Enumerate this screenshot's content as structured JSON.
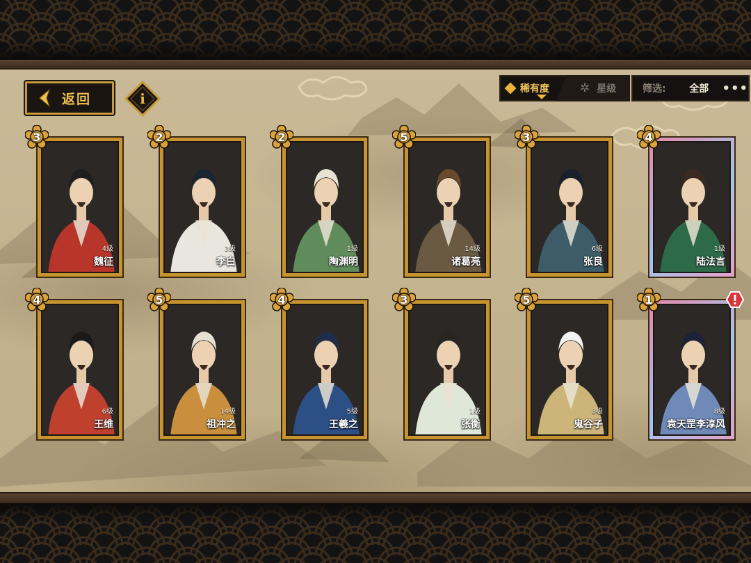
{
  "nav": {
    "back_label": "返回",
    "info_glyph": "i"
  },
  "sort": {
    "rarity_label": "稀有度",
    "star_label": "星级",
    "rarity_active": true
  },
  "filter": {
    "label": "筛选:",
    "value": "全部",
    "more": "•••"
  },
  "colors": {
    "accent_gold": "#c79a3a",
    "active_text": "#f3c65a",
    "alert_red": "#d9343a"
  },
  "cards": [
    {
      "name": "魏征",
      "level": "4级",
      "stars": "3",
      "rare": false,
      "alert": false,
      "robe": "#b7352a",
      "hat": "#1e1e1e"
    },
    {
      "name": "李白",
      "level": "3级",
      "stars": "2",
      "rare": false,
      "alert": false,
      "robe": "#e9e6df",
      "hat": "#1b2433"
    },
    {
      "name": "陶渊明",
      "level": "1级",
      "stars": "2",
      "rare": false,
      "alert": false,
      "robe": "#5f8c5a",
      "hat": "#e8e2d2"
    },
    {
      "name": "诸葛亮",
      "level": "14级",
      "stars": "5",
      "rare": false,
      "alert": false,
      "robe": "#6a5a44",
      "hat": "#6b4a2c"
    },
    {
      "name": "张良",
      "level": "6级",
      "stars": "3",
      "rare": false,
      "alert": false,
      "robe": "#3d5c68",
      "hat": "#1a1f2c"
    },
    {
      "name": "陆法言",
      "level": "1级",
      "stars": "4",
      "rare": true,
      "alert": false,
      "robe": "#2d6a48",
      "hat": "#3a2a22"
    },
    {
      "name": "王维",
      "level": "6级",
      "stars": "4",
      "rare": false,
      "alert": false,
      "robe": "#c0402e",
      "hat": "#1a1a1a"
    },
    {
      "name": "祖冲之",
      "level": "14级",
      "stars": "5",
      "rare": false,
      "alert": false,
      "robe": "#c98f3c",
      "hat": "#e6e0d0"
    },
    {
      "name": "王羲之",
      "level": "5级",
      "stars": "4",
      "rare": false,
      "alert": false,
      "robe": "#2c4f86",
      "hat": "#1e2e4a"
    },
    {
      "name": "张衡",
      "level": "1级",
      "stars": "3",
      "rare": false,
      "alert": false,
      "robe": "#dfe7d8",
      "hat": "#2a2520"
    },
    {
      "name": "鬼谷子",
      "level": "8级",
      "stars": "5",
      "rare": false,
      "alert": false,
      "robe": "#cdb57a",
      "hat": "#f2f2f2"
    },
    {
      "name": "袁天罡李淳风",
      "level": "8级",
      "stars": "1",
      "rare": true,
      "alert": true,
      "robe": "#6f8ab8",
      "hat": "#1c2238"
    }
  ]
}
